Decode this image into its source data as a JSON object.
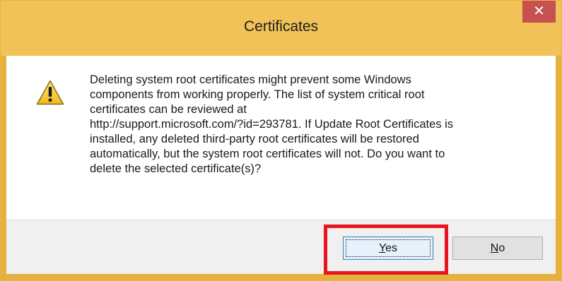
{
  "window": {
    "title": "Certificates",
    "close_glyph": "✕"
  },
  "message": {
    "icon": "warning-icon",
    "text": "Deleting system root certificates might prevent some Windows\ncomponents from working properly. The list of system critical root\ncertificates can be reviewed at\nhttp://support.microsoft.com/?id=293781. If Update Root Certificates is\ninstalled, any deleted third-party root certificates will be restored\nautomatically, but the system root certificates will not. Do you want to\ndelete the selected certificate(s)?"
  },
  "buttons": {
    "yes": {
      "mnemonic": "Y",
      "rest": "es"
    },
    "no": {
      "mnemonic": "N",
      "rest": "o"
    }
  },
  "colors": {
    "title_bar": "#f0c257",
    "close_button": "#c75050",
    "highlight": "#e8141e"
  }
}
